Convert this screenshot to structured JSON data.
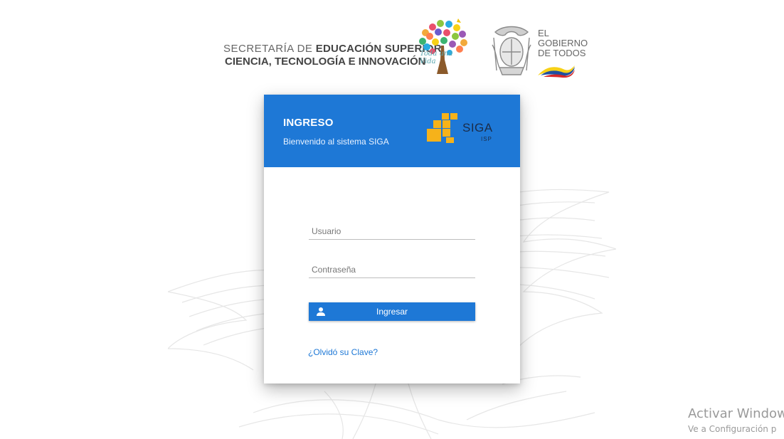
{
  "header": {
    "secretaria_line1_thin": "SECRETARÍA DE",
    "secretaria_line1_bold": "EDUCACIÓN SUPERIOR,",
    "secretaria_line2": "CIENCIA, TECNOLOGÍA E INNOVACIÓN",
    "tree_logo_text": "Toda una Vida",
    "gobierno_line1": "EL",
    "gobierno_line2": "GOBIERNO",
    "gobierno_line3": "DE TODOS"
  },
  "login": {
    "title": "INGRESO",
    "subtitle": "Bienvenido al sistema SIGA",
    "logo_text": "SIGA",
    "logo_subtext": "ISP",
    "username_placeholder": "Usuario",
    "username_value": "",
    "password_placeholder": "Contraseña",
    "password_value": "",
    "submit_label": "Ingresar",
    "forgot_label": "¿Olvidó su Clave?"
  },
  "windows_activation": {
    "title": "Activar Windows",
    "subtitle": "Ve a Configuración p"
  },
  "colors": {
    "primary": "#1e78d6",
    "siga_yellow": "#f6b21a",
    "background": "#ffffff"
  },
  "icons": [
    "user-icon",
    "siga-logo-icon",
    "coat-of-arms-icon",
    "tree-logo-icon"
  ]
}
